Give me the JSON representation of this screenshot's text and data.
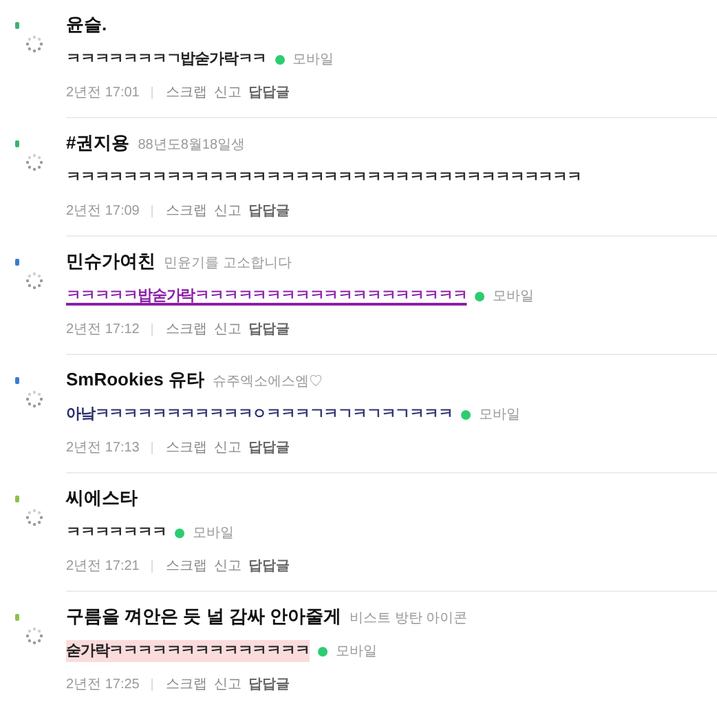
{
  "comments": [
    {
      "color": "#3cb371",
      "name": "윤슬.",
      "text": "ㅋㅋㅋㅋㅋㅋㅋㄱ밥숟가락ㅋㅋ",
      "kind": "plain",
      "mobile": true,
      "mobile_label": "모바일",
      "time": "2년전 17:01",
      "actions": [
        "스크랩",
        "신고"
      ],
      "reply": "답답글"
    },
    {
      "color": "#3cb371",
      "name": "#권지용",
      "subtitle": "88년도8월18일생",
      "text": "ㅋㅋㅋㅋㅋㅋㅋㅋㅋㅋㅋㅋㅋㅋㅋㅋㅋㅋㅋㅋㅋㅋㅋㅋㅋㅋㅋㅋㅋㅋㅋㅋㅋㅋㅋㅋ",
      "kind": "plain",
      "mobile": false,
      "time": "2년전 17:09",
      "actions": [
        "스크랩",
        "신고"
      ],
      "reply": "답답글"
    },
    {
      "color": "#3a7bd5",
      "name": "민슈가여친",
      "subtitle": "민윤기를 고소합니다",
      "text": "ㅋㅋㅋㅋㅋ밥숟가락ㅋㅋㅋㅋㅋㅋㅋㅋㅋㅋㅋㅋㅋㅋㅋㅋㅋㅋㅋ",
      "kind": "link",
      "mobile": true,
      "mobile_label": "모바일",
      "time": "2년전 17:12",
      "actions": [
        "스크랩",
        "신고"
      ],
      "reply": "답답글"
    },
    {
      "color": "#3a7bd5",
      "name": "SmRookies 유타",
      "subtitle": "슈주엑소에스엠♡",
      "text": "아낰ㅋㅋㅋㅋㅋㅋㅋㅋㅋㅋㅋㅇㅋㅋㅋㄱㅋㄱㅋㄱㅋㄱㅋㅋㅋ",
      "kind": "navy",
      "mobile": true,
      "mobile_label": "모바일",
      "time": "2년전 17:13",
      "actions": [
        "스크랩",
        "신고"
      ],
      "reply": "답답글"
    },
    {
      "color": "#8bc34a",
      "name": "씨에스타",
      "text": "ㅋㅋㅋㅋㅋㅋㅋ",
      "kind": "plain",
      "mobile": true,
      "mobile_label": "모바일",
      "time": "2년전 17:21",
      "actions": [
        "스크랩",
        "신고"
      ],
      "reply": "답답글"
    },
    {
      "color": "#8bc34a",
      "name": "구름을 껴안은 듯 널 감싸 안아줄게",
      "subtitle": "비스트 방탄 아이콘",
      "text": "숟가락ㅋㅋㅋㅋㅋㅋㅋㅋㅋㅋㅋㅋㅋㅋ",
      "kind": "highlight",
      "mobile": true,
      "mobile_label": "모바일",
      "time": "2년전 17:25",
      "actions": [
        "스크랩",
        "신고"
      ],
      "reply": "답답글"
    }
  ]
}
